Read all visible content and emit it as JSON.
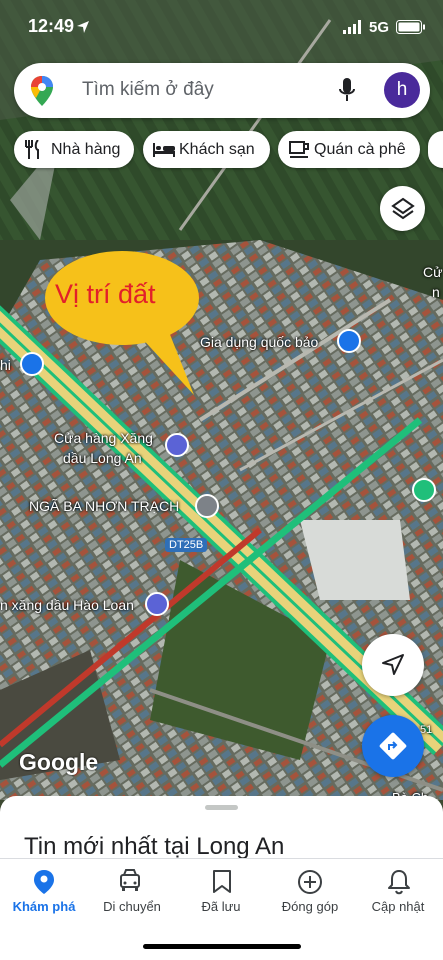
{
  "status_bar": {
    "time": "12:49",
    "network": "5G"
  },
  "search": {
    "placeholder": "Tìm kiếm ở đây",
    "avatar_letter": "h"
  },
  "chips": [
    {
      "label": "Nhà hàng",
      "icon": "restaurant-icon"
    },
    {
      "label": "Khách sạn",
      "icon": "hotel-icon"
    },
    {
      "label": "Quán cà phê",
      "icon": "cafe-icon"
    }
  ],
  "map": {
    "callout": "Vị trí đất",
    "labels": {
      "gia_dung": "Gia dụng quốc bảo",
      "xang_long_an_1": "Cửa hàng Xăng",
      "xang_long_an_2": "dầu Long An",
      "nga_ba": "NGÃ BA NHƠN TRẠCH",
      "road": "DT25B",
      "hao_loan": "n xăng dầu Hào Loan",
      "edge_left": "hi",
      "edge_right_c": "Cử",
      "edge_right_n": "n",
      "road_num": "51",
      "edge_bottom_right": "Bà Ch",
      "google": "Google"
    },
    "colors": {
      "highway_fill": "#e8d37a",
      "traffic_green": "#1fbf7a",
      "traffic_red": "#c0392b",
      "accent": "#1a73e8"
    }
  },
  "sheet": {
    "title": "Tin mới nhất tại Long An"
  },
  "nav": [
    {
      "label": "Khám phá",
      "icon": "explore-pin-icon",
      "active": true
    },
    {
      "label": "Di chuyển",
      "icon": "car-icon",
      "active": false
    },
    {
      "label": "Đã lưu",
      "icon": "bookmark-icon",
      "active": false
    },
    {
      "label": "Đóng góp",
      "icon": "add-circle-icon",
      "active": false
    },
    {
      "label": "Cập nhật",
      "icon": "bell-icon",
      "active": false
    }
  ]
}
